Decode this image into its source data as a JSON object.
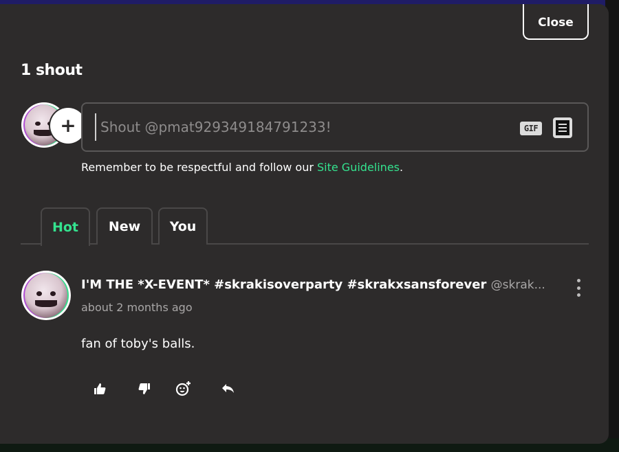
{
  "modal": {
    "close_label": "Close",
    "shout_count": "1 shout"
  },
  "composer": {
    "placeholder": "Shout @pmat929349184791233!",
    "gif_label": "GIF",
    "add_icon": "plus-icon",
    "sticker_icon": "sticker-icon"
  },
  "guidelines": {
    "text_before": "Remember to be respectful and follow our ",
    "link_text": "Site Guidelines",
    "text_after": "."
  },
  "tabs": [
    {
      "label": "Hot",
      "active": true
    },
    {
      "label": "New",
      "active": false
    },
    {
      "label": "You",
      "active": false
    }
  ],
  "post": {
    "title": "I'M THE *X-EVENT* #skrakisoverparty #skrakxsansforever",
    "handle": "@skrak...",
    "time": "about 2 months ago",
    "body": "fan of toby's balls.",
    "actions": [
      "thumbs-up-icon",
      "thumbs-down-icon",
      "add-reaction-icon",
      "reply-icon"
    ]
  },
  "colors": {
    "accent": "#34e38f",
    "panel": "#2d2b2b",
    "muted_text": "#a9a7a7"
  }
}
